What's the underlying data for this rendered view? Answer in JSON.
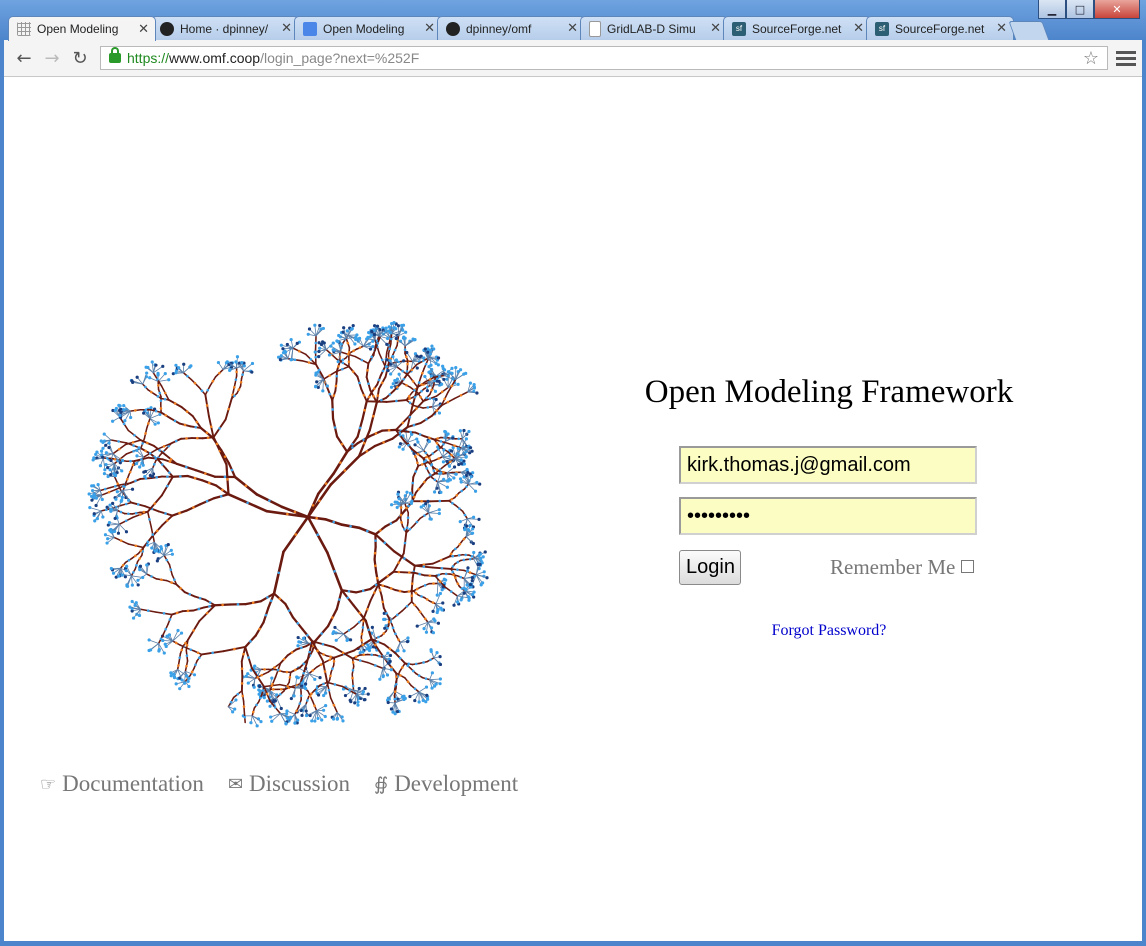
{
  "window": {
    "minimize": "▁",
    "maximize": "□",
    "close": "✕"
  },
  "tabs": [
    {
      "title": "Open Modeling",
      "icon": "grid-icon",
      "active": true
    },
    {
      "title": "Home · dpinney/",
      "icon": "github-icon"
    },
    {
      "title": "Open Modeling",
      "icon": "document-icon"
    },
    {
      "title": "dpinney/omf",
      "icon": "github-icon"
    },
    {
      "title": "GridLAB-D Simu",
      "icon": "page-icon"
    },
    {
      "title": "SourceForge.net",
      "icon": "sourceforge-icon"
    },
    {
      "title": "SourceForge.net",
      "icon": "sourceforge-icon"
    }
  ],
  "toolbar": {
    "url_scheme": "https://",
    "url_host": "www.omf.coop",
    "url_path": "/login_page?next=%252F"
  },
  "login": {
    "heading": "Open Modeling Framework",
    "email_value": "kirk.thomas.j@gmail.com",
    "password_value": "•••••••••",
    "login_button": "Login",
    "remember_label": "Remember Me",
    "forgot_link": "Forgot Password?"
  },
  "footer_links": [
    {
      "label": "Documentation",
      "icon": "☞"
    },
    {
      "label": "Discussion",
      "icon": "✉"
    },
    {
      "label": "Development",
      "icon": "∯"
    }
  ],
  "colors": {
    "tree_line": "#6b1a10",
    "node_blue": "#3aa0e8",
    "node_orange": "#f08020",
    "accent_link": "#0000cc",
    "field_bg": "#fbfdc2"
  }
}
